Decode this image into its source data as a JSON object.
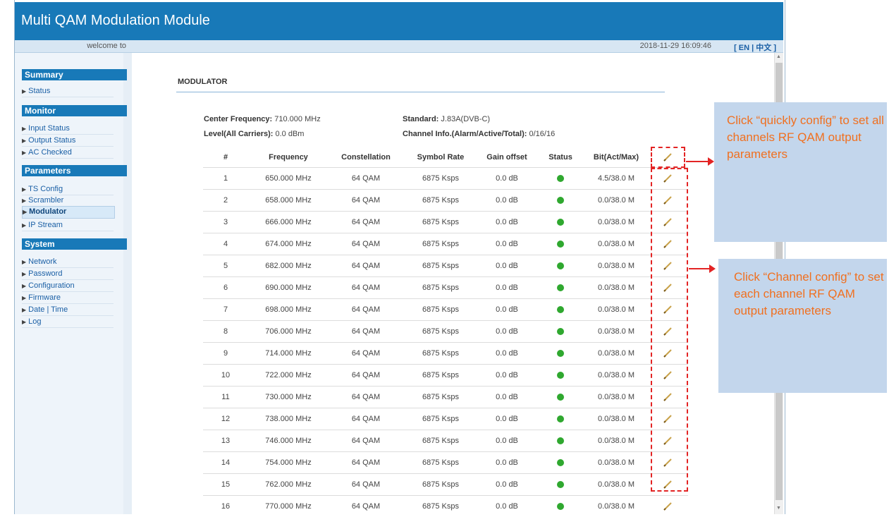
{
  "app_title": "Multi QAM Modulation Module",
  "subbar": {
    "welcome": "welcome to",
    "datetime": "2018-11-29 16:09:46",
    "lang": "[ EN | 中文 ]"
  },
  "sidebar": {
    "summary": {
      "title": "Summary",
      "items": [
        "Status"
      ]
    },
    "monitor": {
      "title": "Monitor",
      "items": [
        "Input Status",
        "Output Status",
        "AC Checked"
      ]
    },
    "parameters": {
      "title": "Parameters",
      "items": [
        "TS Config",
        "Scrambler",
        "Modulator",
        "IP Stream"
      ],
      "active": "Modulator"
    },
    "system": {
      "title": "System",
      "items": [
        "Network",
        "Password",
        "Configuration",
        "Firmware",
        "Date | Time",
        "Log"
      ]
    }
  },
  "main": {
    "title": "MODULATOR",
    "center_frequency_label": "Center Frequency:",
    "center_frequency_value": "710.000 MHz",
    "standard_label": "Standard:",
    "standard_value": "J.83A(DVB-C)",
    "level_label": "Level(All Carriers):",
    "level_value": "0.0 dBm",
    "channel_info_label": "Channel Info.(Alarm/Active/Total):",
    "channel_info_value": "0/16/16"
  },
  "table": {
    "headers": [
      "#",
      "Frequency",
      "Constellation",
      "Symbol Rate",
      "Gain offset",
      "Status",
      "Bit(Act/Max)"
    ],
    "rows": [
      [
        "1",
        "650.000 MHz",
        "64 QAM",
        "6875 Ksps",
        "0.0 dB",
        "4.5/38.0 M"
      ],
      [
        "2",
        "658.000 MHz",
        "64 QAM",
        "6875 Ksps",
        "0.0 dB",
        "0.0/38.0 M"
      ],
      [
        "3",
        "666.000 MHz",
        "64 QAM",
        "6875 Ksps",
        "0.0 dB",
        "0.0/38.0 M"
      ],
      [
        "4",
        "674.000 MHz",
        "64 QAM",
        "6875 Ksps",
        "0.0 dB",
        "0.0/38.0 M"
      ],
      [
        "5",
        "682.000 MHz",
        "64 QAM",
        "6875 Ksps",
        "0.0 dB",
        "0.0/38.0 M"
      ],
      [
        "6",
        "690.000 MHz",
        "64 QAM",
        "6875 Ksps",
        "0.0 dB",
        "0.0/38.0 M"
      ],
      [
        "7",
        "698.000 MHz",
        "64 QAM",
        "6875 Ksps",
        "0.0 dB",
        "0.0/38.0 M"
      ],
      [
        "8",
        "706.000 MHz",
        "64 QAM",
        "6875 Ksps",
        "0.0 dB",
        "0.0/38.0 M"
      ],
      [
        "9",
        "714.000 MHz",
        "64 QAM",
        "6875 Ksps",
        "0.0 dB",
        "0.0/38.0 M"
      ],
      [
        "10",
        "722.000 MHz",
        "64 QAM",
        "6875 Ksps",
        "0.0 dB",
        "0.0/38.0 M"
      ],
      [
        "11",
        "730.000 MHz",
        "64 QAM",
        "6875 Ksps",
        "0.0 dB",
        "0.0/38.0 M"
      ],
      [
        "12",
        "738.000 MHz",
        "64 QAM",
        "6875 Ksps",
        "0.0 dB",
        "0.0/38.0 M"
      ],
      [
        "13",
        "746.000 MHz",
        "64 QAM",
        "6875 Ksps",
        "0.0 dB",
        "0.0/38.0 M"
      ],
      [
        "14",
        "754.000 MHz",
        "64 QAM",
        "6875 Ksps",
        "0.0 dB",
        "0.0/38.0 M"
      ],
      [
        "15",
        "762.000 MHz",
        "64 QAM",
        "6875 Ksps",
        "0.0 dB",
        "0.0/38.0 M"
      ],
      [
        "16",
        "770.000 MHz",
        "64 QAM",
        "6875 Ksps",
        "0.0 dB",
        "0.0/38.0 M"
      ]
    ],
    "status_color": "#2fa82f",
    "edit_icon": "pencil-icon"
  },
  "annotations": {
    "quick_config": "Click “quickly config” to set all channels RF QAM output parameters",
    "channel_config": "Click “Channel config” to set each channel RF QAM output parameters",
    "highlight_color": "#e32424",
    "callout_text_color": "#f07020"
  }
}
